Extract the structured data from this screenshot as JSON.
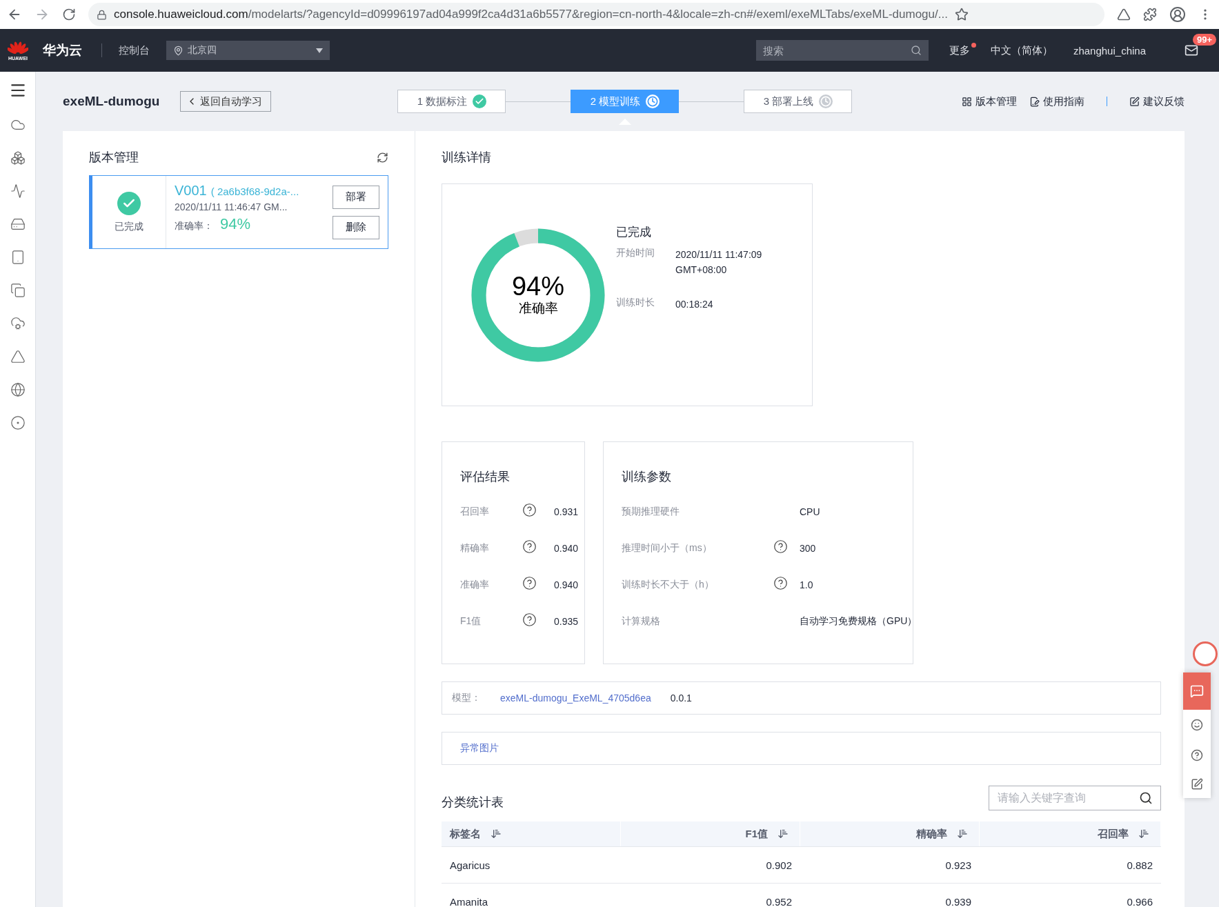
{
  "browser": {
    "url_host": "console.huaweicloud.com",
    "url_path": "/modelarts/?agencyId=d09996197ad04a999f2ca4d31a6b5577&region=cn-north-4&locale=zh-cn#/exeml/exeMLTabs/exeML-dumogu/..."
  },
  "topbar": {
    "logo_text": "HUAWEI",
    "brand": "华为云",
    "console": "控制台",
    "region": "北京四",
    "search_placeholder": "搜索",
    "more": {
      "label": "更多",
      "dot": true
    },
    "language": "中文（简体）",
    "user": "zhanghui_china",
    "mail_badge": "99+"
  },
  "header": {
    "title": "exeML-dumogu",
    "back": "返回自动学习",
    "steps": [
      {
        "label": "1 数据标注",
        "done": true,
        "selected": false
      },
      {
        "label": "2 模型训练",
        "done": false,
        "selected": true
      },
      {
        "label": "3 部署上线",
        "done": false,
        "selected": false
      }
    ],
    "links": [
      {
        "kind": "grid",
        "label": "版本管理"
      },
      {
        "kind": "guide",
        "label": "使用指南"
      },
      {
        "kind": "feedback",
        "label": "建议反馈"
      }
    ]
  },
  "versions": {
    "title": "版本管理",
    "items": [
      {
        "status": "已完成",
        "done": true,
        "name": "V001",
        "id": "( 2a6b3f68-9d2a-...",
        "time": "2020/11/11 11:46:47 GM...",
        "accuracy_label": "准确率：",
        "accuracy": "94%",
        "actions": [
          "部署",
          "删除"
        ],
        "selected": true
      }
    ]
  },
  "details": {
    "title": "训练详情",
    "summary": {
      "level": 0.94,
      "value": "94%",
      "caption": "准确率",
      "status": "已完成",
      "fields": [
        {
          "label": "开始时间",
          "value": "2020/11/11 11:47:09 GMT+08:00"
        },
        {
          "label": "训练时长",
          "value": "00:18:24"
        }
      ]
    }
  },
  "evaluation": {
    "title": "评估结果",
    "rows": [
      {
        "label": "召回率",
        "help": true,
        "value": "0.931"
      },
      {
        "label": "精确率",
        "help": true,
        "value": "0.940"
      },
      {
        "label": "准确率",
        "help": true,
        "value": "0.940"
      },
      {
        "label": "F1值",
        "help": true,
        "value": "0.935"
      }
    ]
  },
  "params": {
    "title": "训练参数",
    "rows": [
      {
        "label": "预期推理硬件",
        "help": false,
        "value": "CPU"
      },
      {
        "label": "推理时间小于（ms）",
        "help": true,
        "value": "300"
      },
      {
        "label": "训练时长不大于（h）",
        "help": true,
        "value": "1.0"
      },
      {
        "label": "计算规格",
        "help": false,
        "value": "自动学习免费规格（GPU）"
      }
    ]
  },
  "model": {
    "label": "模型：",
    "name": "exeML-dumogu_ExeML_4705d6ea",
    "version": "0.0.1"
  },
  "anomaly_link": "异常图片",
  "stats": {
    "title": "分类统计表",
    "search_placeholder": "请输入关键字查询",
    "columns": [
      "标签名",
      "F1值",
      "精确率",
      "召回率"
    ],
    "rows": [
      [
        "Agaricus",
        "0.902",
        "0.923",
        "0.882"
      ],
      [
        "Amanita",
        "0.952",
        "0.939",
        "0.966"
      ]
    ]
  }
}
